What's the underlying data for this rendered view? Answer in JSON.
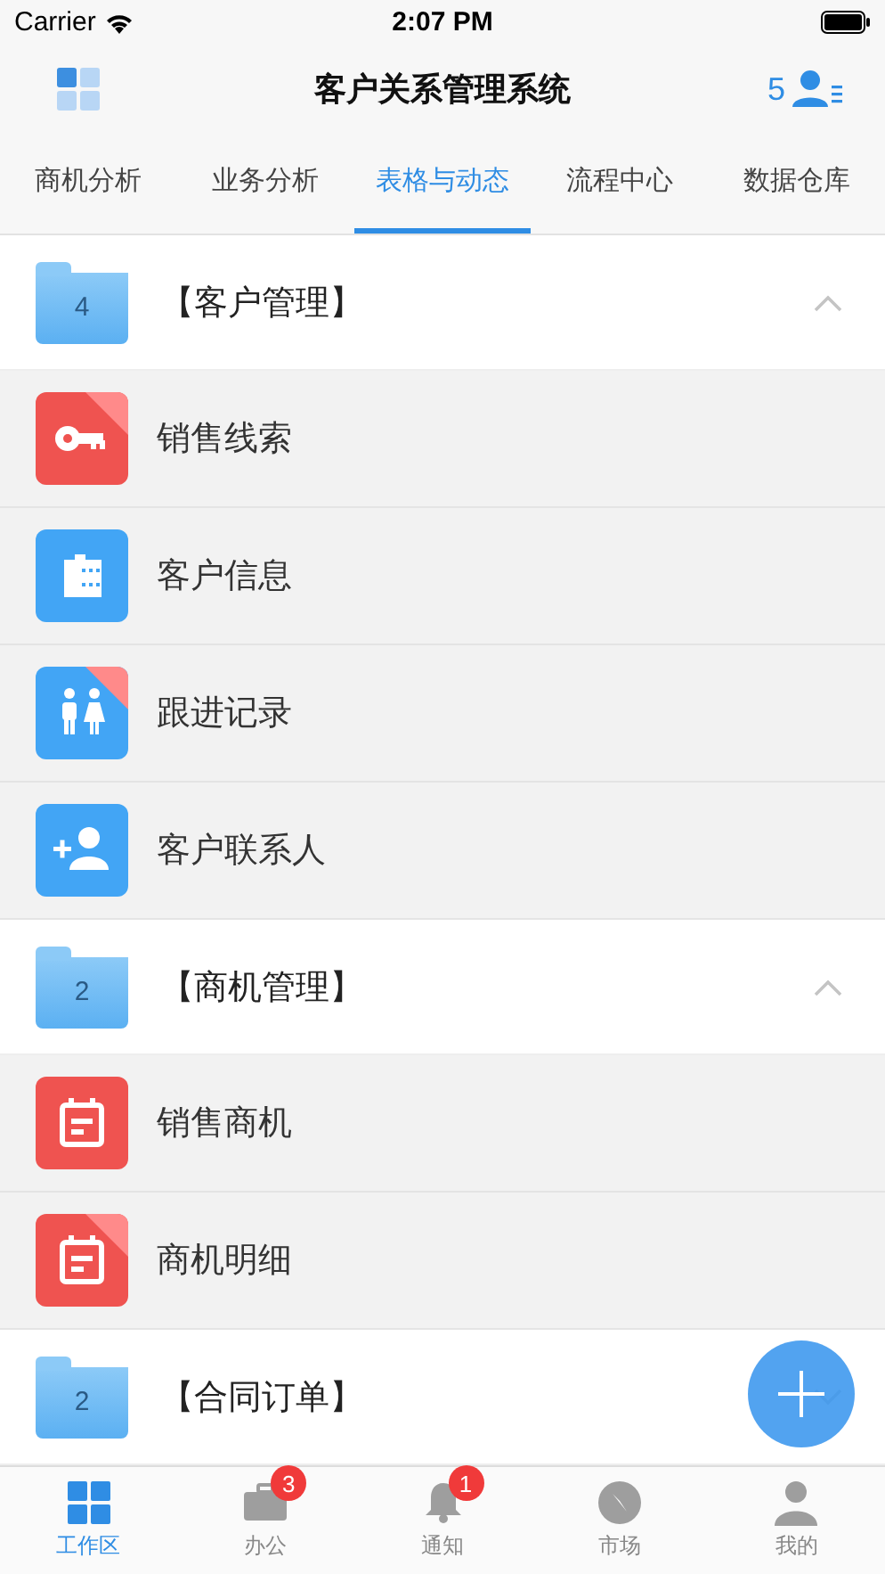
{
  "status_bar": {
    "carrier": "Carrier",
    "time": "2:07 PM"
  },
  "header": {
    "title": "客户关系管理系统",
    "count": "5"
  },
  "tabs": [
    {
      "label": "商机分析",
      "selected": false
    },
    {
      "label": "业务分析",
      "selected": false
    },
    {
      "label": "表格与动态",
      "selected": true
    },
    {
      "label": "流程中心",
      "selected": false
    },
    {
      "label": "数据仓库",
      "selected": false
    }
  ],
  "groups": [
    {
      "count": "4",
      "title": "【客户管理】",
      "expanded": true,
      "items": [
        {
          "label": "销售线索",
          "kind": "key",
          "color": "#ef5350",
          "flagged": true
        },
        {
          "label": "客户信息",
          "kind": "film",
          "color": "#42a5f5",
          "flagged": false
        },
        {
          "label": "跟进记录",
          "kind": "people",
          "color": "#42a5f5",
          "flagged": true
        },
        {
          "label": "客户联系人",
          "kind": "person-add",
          "color": "#42a5f5",
          "flagged": false
        }
      ]
    },
    {
      "count": "2",
      "title": "【商机管理】",
      "expanded": true,
      "items": [
        {
          "label": "销售商机",
          "kind": "calendar",
          "color": "#ef5350",
          "flagged": false
        },
        {
          "label": "商机明细",
          "kind": "calendar",
          "color": "#ef5350",
          "flagged": true
        }
      ]
    },
    {
      "count": "2",
      "title": "【合同订单】",
      "expanded": false
    }
  ],
  "bottom_nav": [
    {
      "label": "工作区",
      "kind": "grid",
      "selected": true
    },
    {
      "label": "办公",
      "kind": "briefcase",
      "selected": false,
      "badge": "3"
    },
    {
      "label": "通知",
      "kind": "bell",
      "selected": false,
      "badge": "1"
    },
    {
      "label": "市场",
      "kind": "compass",
      "selected": false
    },
    {
      "label": "我的",
      "kind": "person",
      "selected": false
    }
  ]
}
